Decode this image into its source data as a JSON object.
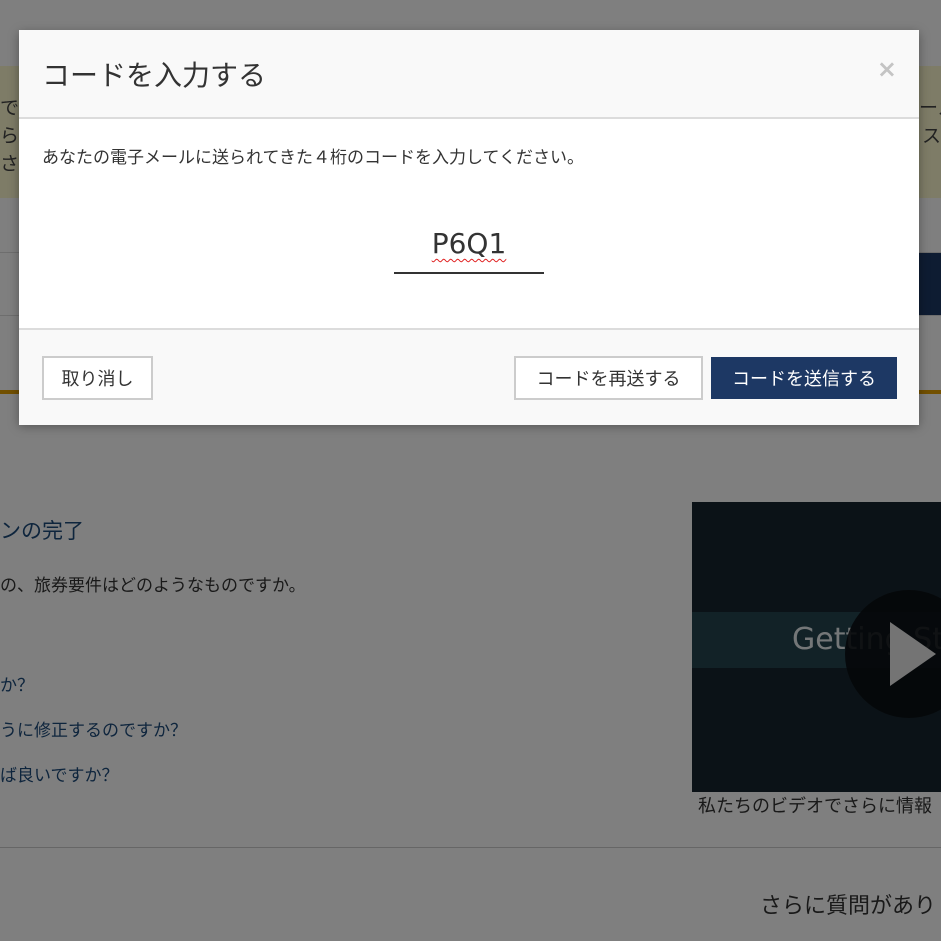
{
  "background": {
    "notice_left": "でき\nら\nさ",
    "notice_right": "ール\nス",
    "faq_heading": "ンの完了",
    "faq_sub": "の、旅券要件はどのようなものですか。",
    "faq_items": [
      "か？",
      "うに修正するのですか？",
      "ば良いですか？"
    ],
    "video_title": "Getting St",
    "video_caption": "私たちのビデオでさらに情報",
    "more_questions": "さらに質問があり"
  },
  "modal": {
    "title": "コードを入力する",
    "close_symbol": "×",
    "instruction": "あなたの電子メールに送られてきた４桁のコードを入力してください。",
    "code_value": "P6Q1",
    "cancel_label": "取り消し",
    "resend_label": "コードを再送する",
    "submit_label": "コードを送信する"
  },
  "colors": {
    "primary": "#1d3864",
    "accent": "#e4a100",
    "notice": "#fdf8cf"
  }
}
